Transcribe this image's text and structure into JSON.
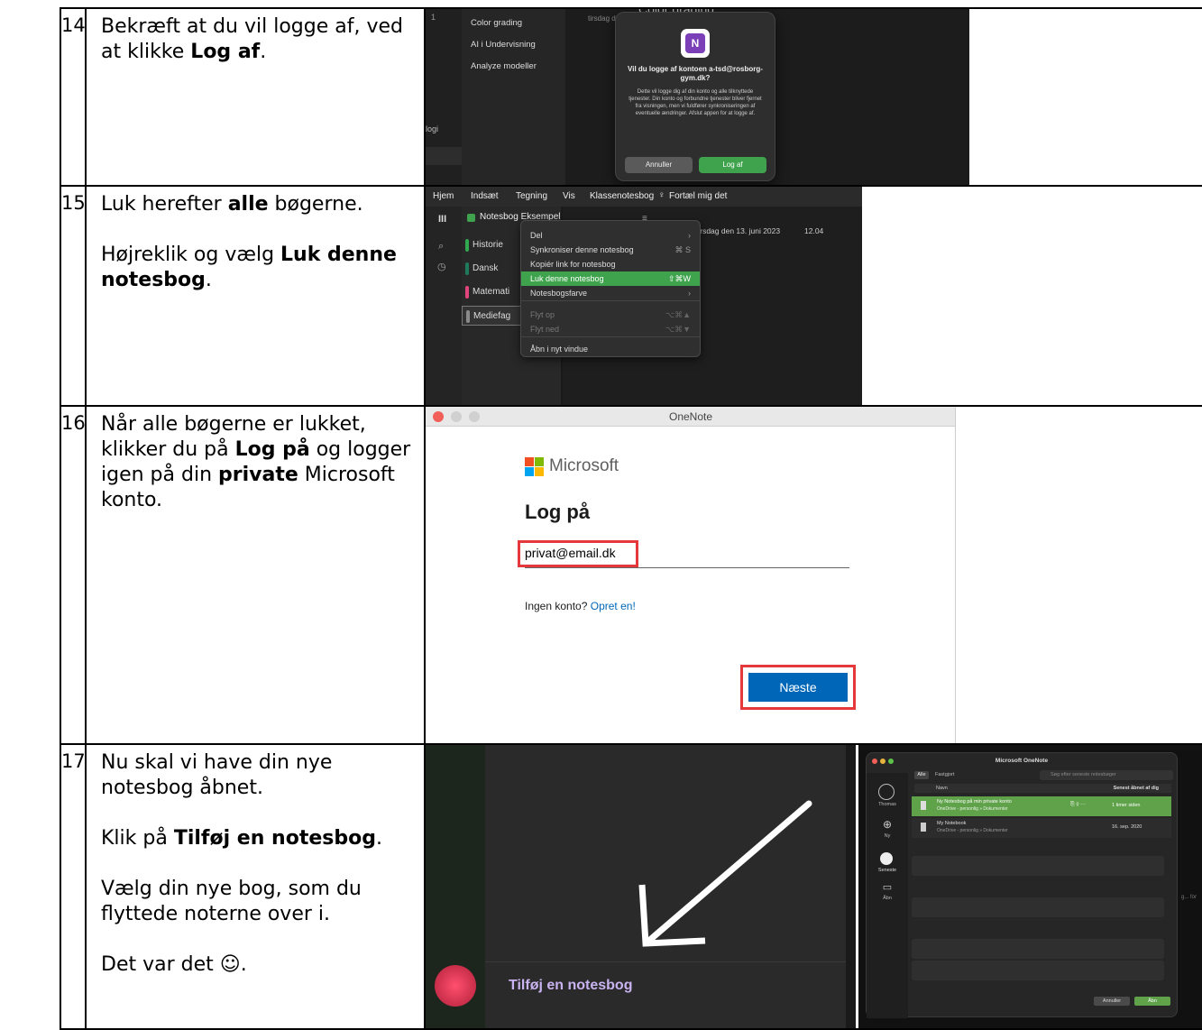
{
  "rows": [
    {
      "num": "14",
      "text_a": "Bekræft at du vil logge af, ved at klikke ",
      "text_bold": "Log af",
      "text_b": ".",
      "shot": {
        "sidebar_items": [
          "Color grading",
          "AI i Undervisning",
          "Analyze modeller"
        ],
        "left_fragment": "logi",
        "header_fragment": "Color grading",
        "date_fragment": "tirsdag d",
        "dialog_title": "Vil du logge af kontoen a-tsd@rosborg-gym.dk?",
        "dialog_body": "Dette vil logge dig af din konto og alle tilknyttede tjenester. Din konto og forbundne tjenester bliver fjernet fra visningen, men vi fuldfører synkroniseringen af eventuelle ændringer. Afslut appen for at logge af.",
        "cancel": "Annuller",
        "logoff": "Log af"
      }
    },
    {
      "num": "15",
      "text_a": "Luk herefter ",
      "text_bold": "alle",
      "text_b": " bøgerne.",
      "text2_a": "Højreklik og vælg ",
      "text2_bold": "Luk denne notesbog",
      "text2_b": ".",
      "shot": {
        "ribbon": [
          "Hjem",
          "Indsæt",
          "Tegning",
          "Vis",
          "Klassenotesbog",
          "Fortæl mig det"
        ],
        "notebook_title": "Notesbog Eksempel",
        "date": "tirsdag den 13. juni 2023",
        "time": "12.04",
        "sections": [
          {
            "label": "Historie",
            "color": "#2fa84f"
          },
          {
            "label": "Dansk",
            "color": "#1e7a5a"
          },
          {
            "label": "Matemati",
            "color": "#e0457b"
          },
          {
            "label": "Mediefag",
            "color": "#8a8a8a"
          }
        ],
        "menu": [
          {
            "label": "Del",
            "key": "›"
          },
          {
            "label": "Synkroniser denne notesbog",
            "key": "⌘ S"
          },
          {
            "label": "Kopiér link for notesbog",
            "key": ""
          },
          {
            "label": "Luk denne notesbog",
            "key": "⇧⌘W"
          },
          {
            "label": "Notesbogsfarve",
            "key": "›"
          },
          {
            "label": "Flyt op",
            "key": "⌥⌘▲"
          },
          {
            "label": "Flyt ned",
            "key": "⌥⌘▼"
          },
          {
            "label": "Åbn i nyt vindue",
            "key": ""
          }
        ]
      }
    },
    {
      "num": "16",
      "text_a": "Når alle bøgerne er lukket, klikker du på ",
      "text_bold": "Log på",
      "text_b": " og logger igen på din ",
      "text_bold2": "private",
      "text_c": " Microsoft konto.",
      "shot": {
        "window_title": "OneNote",
        "brand": "Microsoft",
        "heading": "Log på",
        "email": "privat@email.dk",
        "no_account": "Ingen konto?",
        "create": "Opret en!",
        "next": "Næste"
      }
    },
    {
      "num": "17",
      "text1": "Nu skal vi have din nye notesbog åbnet.",
      "text2_a": "Klik på ",
      "text2_bold": "Tilføj en notesbog",
      "text2_b": ".",
      "text3": "Vælg din nye bog, som du flyttede noterne over i.",
      "text4": "Det var det ☺.",
      "shot": {
        "add_notebook": "Tilføj en notesbog",
        "app_title": "Microsoft OneNote",
        "filter_all": "Alle",
        "filter_pinned": "Fastgjort",
        "search_placeholder": "Søg efter seneste notesbøger",
        "col_name": "Navn",
        "col_opened": "Senest åbnet af dig",
        "nav": [
          "Thomas",
          "Ny",
          "Seneste",
          "Åbn"
        ],
        "items": [
          {
            "name": "Ny Notesbog på min private konto",
            "loc": "OneDrive - personlig » Dokumenter",
            "date": "1 timer siden"
          },
          {
            "name": "My Notebook",
            "loc": "OneDrive - personlig » Dokumenter",
            "date": "16. sep. 2020"
          }
        ],
        "side_fragment": "g... for",
        "cancel": "Annuller",
        "open": "Åbn"
      }
    }
  ]
}
